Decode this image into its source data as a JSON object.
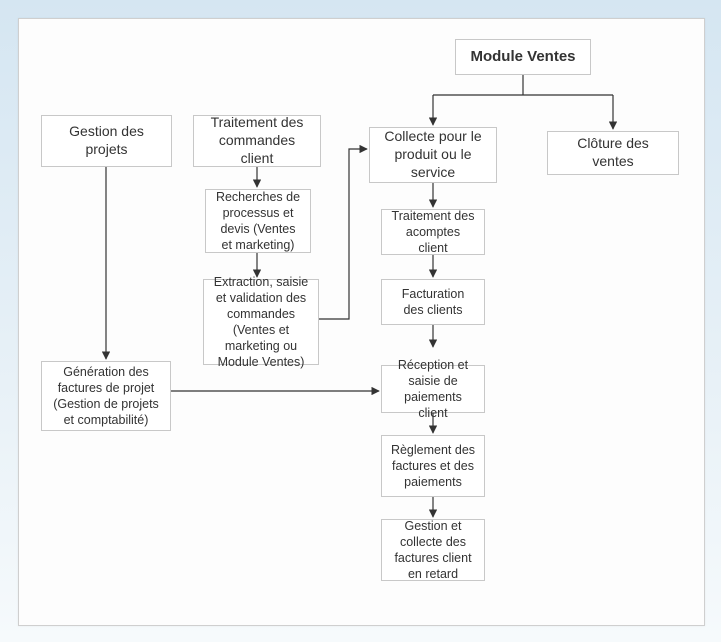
{
  "root": "Module Ventes",
  "col1_header": "Gestion des projets",
  "col1_gen": "Génération des factures de projet (Gestion de projets et comptabilité)",
  "col2_header": "Traitement des commandes client",
  "col2_research": "Recherches de processus et devis (Ventes et marketing)",
  "col2_extract": "Extraction, saisie et validation des commandes (Ventes et marketing ou Module Ventes)",
  "col3_header": "Collecte pour le produit ou le service",
  "col3_deposit": "Traitement des acomptes client",
  "col3_invoice": "Facturation des clients",
  "col3_receipt": "Réception et saisie de paiements client",
  "col3_settle": "Règlement des factures et des paiements",
  "col3_overdue": "Gestion et collecte des factures client en retard",
  "col4_header": "Clôture des ventes"
}
